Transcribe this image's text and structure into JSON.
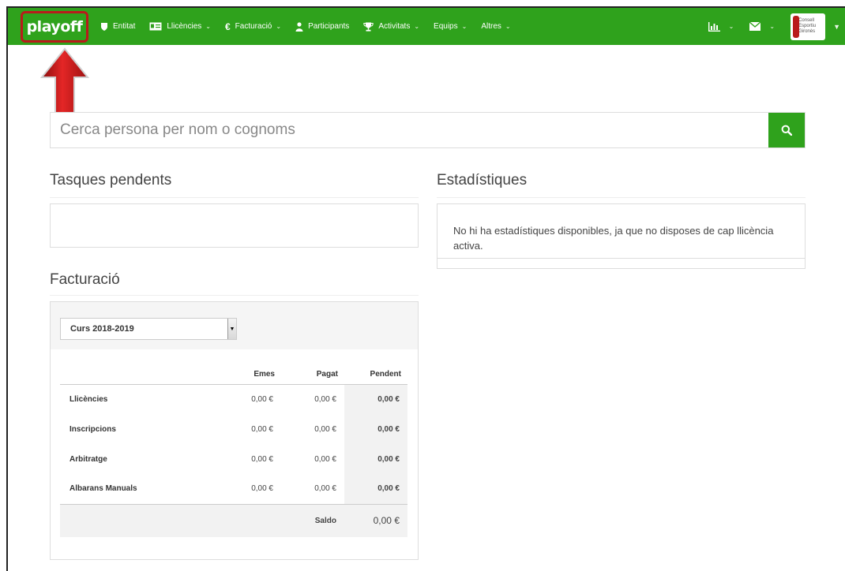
{
  "navbar": {
    "brand": "playoff",
    "items": [
      {
        "label": "Entitat",
        "icon": "shield-icon",
        "caret": false
      },
      {
        "label": "Llicències",
        "icon": "id-card-icon",
        "caret": true
      },
      {
        "label": "Facturació",
        "icon": "euro-icon",
        "caret": true
      },
      {
        "label": "Participants",
        "icon": "user-icon",
        "caret": false
      },
      {
        "label": "Activitats",
        "icon": "trophy-icon",
        "caret": true
      },
      {
        "label": "Equips",
        "icon": "",
        "caret": true
      },
      {
        "label": "Altres",
        "icon": "",
        "caret": true
      }
    ],
    "right": {
      "stats_icon": "bar-chart-icon",
      "mail_icon": "envelope-icon",
      "avatar_text": [
        "Consell",
        "Esportiu",
        "Gironès"
      ]
    },
    "color": "#2fa21c"
  },
  "search": {
    "placeholder": "Cerca persona per nom o cognoms"
  },
  "tasques": {
    "title": "Tasques pendents"
  },
  "estadistiques": {
    "title": "Estadístiques",
    "message": "No hi ha estadístiques disponibles, ja que no disposes de cap llicència activa."
  },
  "facturacio": {
    "title": "Facturació",
    "selected_course": "Curs 2018-2019",
    "columns": [
      "",
      "Emes",
      "Pagat",
      "Pendent"
    ],
    "rows": [
      {
        "name": "Llicències",
        "emes": "0,00 €",
        "pagat": "0,00 €",
        "pendent": "0,00 €"
      },
      {
        "name": "Inscripcions",
        "emes": "0,00 €",
        "pagat": "0,00 €",
        "pendent": "0,00 €"
      },
      {
        "name": "Arbitratge",
        "emes": "0,00 €",
        "pagat": "0,00 €",
        "pendent": "0,00 €"
      },
      {
        "name": "Albarans Manuals",
        "emes": "0,00 €",
        "pagat": "0,00 €",
        "pendent": "0,00 €"
      }
    ],
    "saldo_label": "Saldo",
    "saldo_value": "0,00 €"
  }
}
